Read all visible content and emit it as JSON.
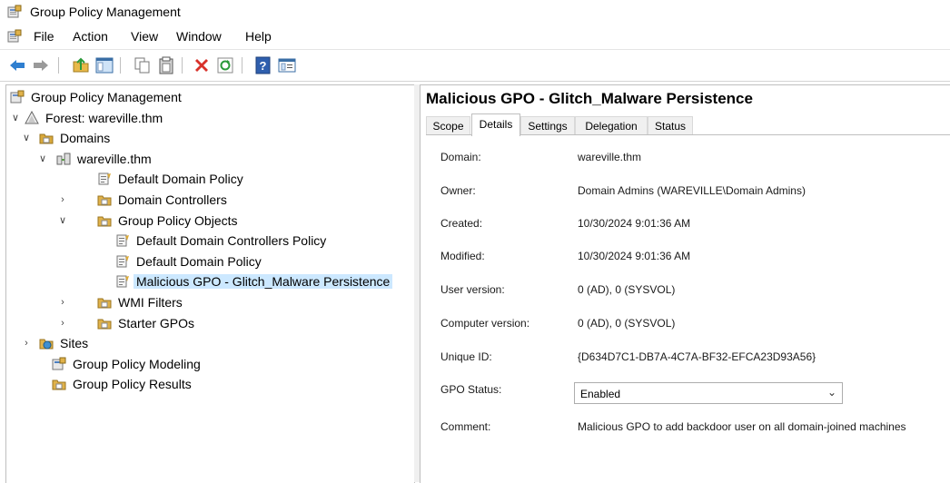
{
  "window": {
    "title": "Group Policy Management"
  },
  "menu": [
    "File",
    "Action",
    "View",
    "Window",
    "Help"
  ],
  "toolbar": [
    "back-arrow-icon",
    "forward-arrow-icon",
    "up-folder-icon",
    "show-hide-tree-icon",
    "copy-icon",
    "paste-icon",
    "delete-icon",
    "refresh-icon",
    "help-icon",
    "properties-icon"
  ],
  "tree": [
    {
      "label": "Group Policy Management",
      "icon": "gpm-icon",
      "expander": ""
    },
    {
      "label": "Forest: wareville.thm",
      "icon": "forest-icon",
      "expander": "expanded"
    },
    {
      "label": "Domains",
      "icon": "domains-folder-icon",
      "expander": "expanded"
    },
    {
      "label": "wareville.thm",
      "icon": "domain-icon",
      "expander": "expanded"
    },
    {
      "label": "Default Domain Policy",
      "icon": "gpo-link-icon",
      "expander": ""
    },
    {
      "label": "Domain Controllers",
      "icon": "ou-folder-icon",
      "expander": "collapsed"
    },
    {
      "label": "Group Policy Objects",
      "icon": "gpo-folder-icon",
      "expander": "expanded"
    },
    {
      "label": "Default Domain Controllers Policy",
      "icon": "gpo-icon",
      "expander": ""
    },
    {
      "label": "Default Domain Policy",
      "icon": "gpo-icon",
      "expander": ""
    },
    {
      "label": "Malicious GPO - Glitch_Malware Persistence",
      "icon": "gpo-icon",
      "expander": "",
      "selected": true
    },
    {
      "label": "WMI Filters",
      "icon": "wmi-folder-icon",
      "expander": "collapsed"
    },
    {
      "label": "Starter GPOs",
      "icon": "starter-folder-icon",
      "expander": "collapsed"
    },
    {
      "label": "Sites",
      "icon": "sites-icon",
      "expander": "collapsed"
    },
    {
      "label": "Group Policy Modeling",
      "icon": "modeling-icon",
      "expander": ""
    },
    {
      "label": "Group Policy Results",
      "icon": "results-icon",
      "expander": ""
    }
  ],
  "details": {
    "title": "Malicious GPO - Glitch_Malware Persistence",
    "tabs": [
      "Scope",
      "Details",
      "Settings",
      "Delegation",
      "Status"
    ],
    "active_tab": "Details",
    "properties": [
      {
        "label": "Domain:",
        "value": "wareville.thm"
      },
      {
        "label": "Owner:",
        "value": "Domain Admins (WAREVILLE\\Domain Admins)"
      },
      {
        "label": "Created:",
        "value": "10/30/2024 9:01:36 AM"
      },
      {
        "label": "Modified:",
        "value": "10/30/2024 9:01:36 AM"
      },
      {
        "label": "User version:",
        "value": "0 (AD), 0 (SYSVOL)"
      },
      {
        "label": "Computer version:",
        "value": "0 (AD), 0 (SYSVOL)"
      },
      {
        "label": "Unique ID:",
        "value": "{D634D7C1-DB7A-4C7A-BF32-EFCA23D93A56}"
      },
      {
        "label": "GPO Status:",
        "value": "Enabled"
      },
      {
        "label": "Comment:",
        "value": "Malicious GPO to add backdoor user on all domain-joined machines"
      }
    ]
  }
}
